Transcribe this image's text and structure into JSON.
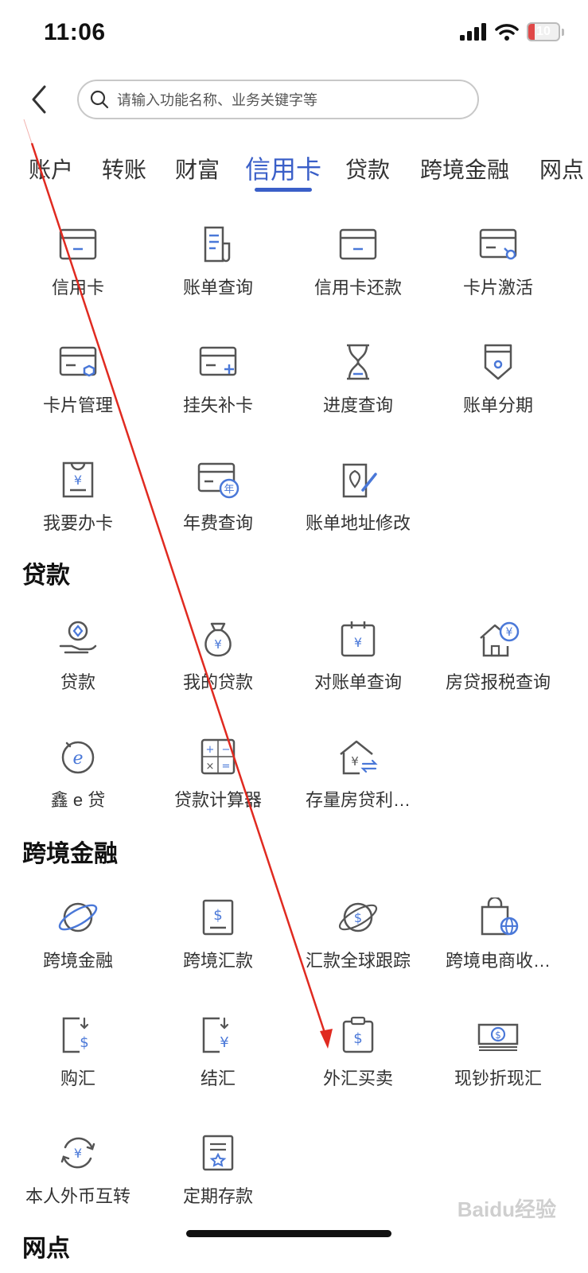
{
  "status": {
    "time": "11:06",
    "battery": "10"
  },
  "header": {
    "search_placeholder": "请输入功能名称、业务关键字等"
  },
  "tabs": [
    "账户",
    "转账",
    "财富",
    "信用卡",
    "贷款",
    "跨境金融",
    "网点"
  ],
  "credit_card": {
    "items": [
      "信用卡",
      "账单查询",
      "信用卡还款",
      "卡片激活",
      "卡片管理",
      "挂失补卡",
      "进度查询",
      "账单分期",
      "我要办卡",
      "年费查询",
      "账单地址修改"
    ]
  },
  "loan": {
    "title": "贷款",
    "items": [
      "贷款",
      "我的贷款",
      "对账单查询",
      "房贷报税查询",
      "鑫 e 贷",
      "贷款计算器",
      "存量房贷利…"
    ]
  },
  "cross_border": {
    "title": "跨境金融",
    "items": [
      "跨境金融",
      "跨境汇款",
      "汇款全球跟踪",
      "跨境电商收…",
      "购汇",
      "结汇",
      "外汇买卖",
      "现钞折现汇",
      "本人外币互转",
      "定期存款"
    ]
  },
  "branch": {
    "title": "网点"
  },
  "watermark": "Baidu经验",
  "colors": {
    "accent": "#3a5fc8",
    "icon_blue": "#4a78d8",
    "annotation": "#e02a20"
  }
}
